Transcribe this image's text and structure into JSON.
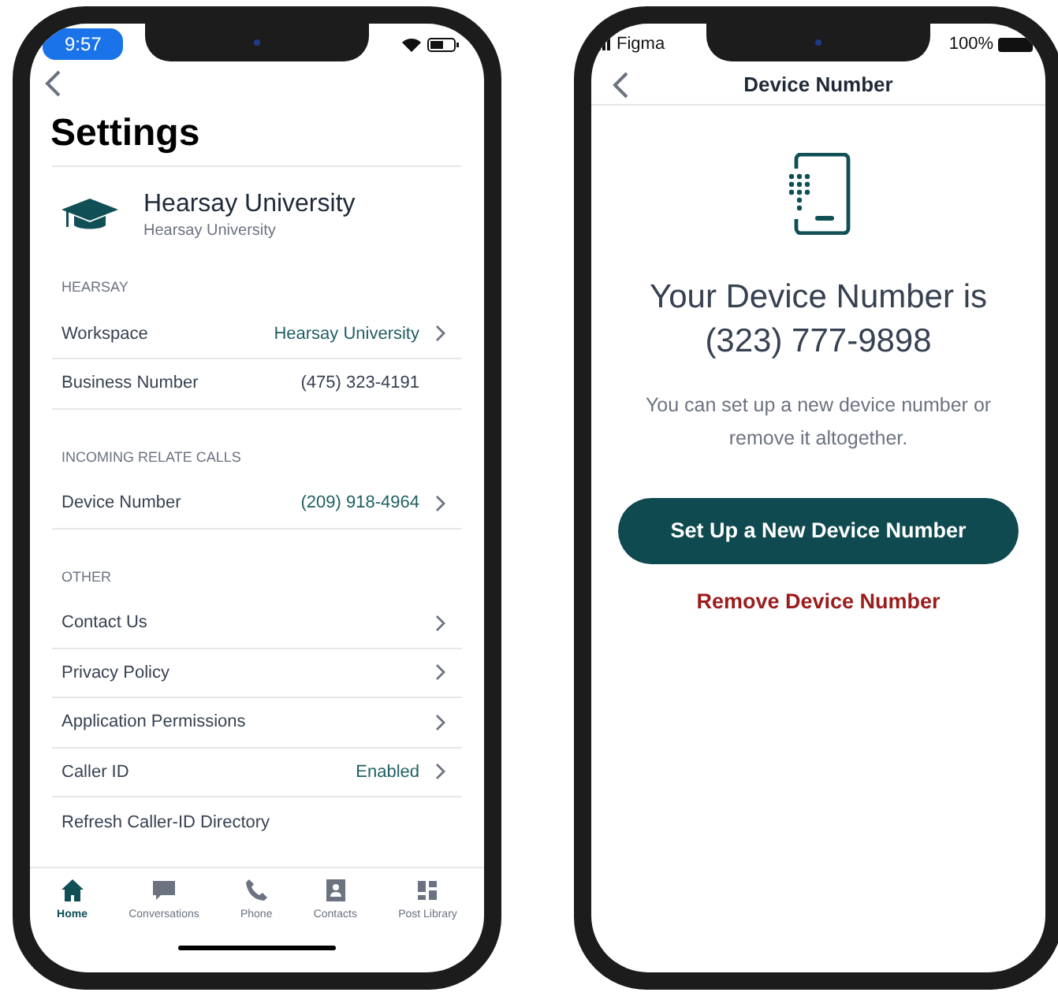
{
  "settings_screen": {
    "status_bar": {
      "time": "9:57"
    },
    "title": "Settings",
    "account": {
      "name": "Hearsay University",
      "subtitle": "Hearsay University"
    },
    "sections": [
      {
        "header": "HEARSAY",
        "rows": [
          {
            "label": "Workspace",
            "value": "Hearsay University",
            "accent": true,
            "chevron": true
          },
          {
            "label": "Business Number",
            "value": "(475) 323-4191",
            "accent": false,
            "chevron": false
          }
        ]
      },
      {
        "header": "INCOMING RELATE CALLS",
        "rows": [
          {
            "label": "Device Number",
            "value": "(209) 918-4964",
            "accent": true,
            "chevron": true
          }
        ]
      },
      {
        "header": "OTHER",
        "rows": [
          {
            "label": "Contact Us",
            "chevron": true
          },
          {
            "label": "Privacy Policy",
            "chevron": true
          },
          {
            "label": "Application Permissions",
            "chevron": true
          },
          {
            "label": "Caller ID",
            "value": "Enabled",
            "accent": true,
            "chevron": true
          },
          {
            "label": "Refresh Caller-ID Directory",
            "chevron": false
          }
        ]
      }
    ],
    "tab_bar": [
      {
        "kind": "home",
        "label": "Home",
        "selected": true
      },
      {
        "kind": "chat",
        "label": "Conversations",
        "selected": false
      },
      {
        "kind": "phone",
        "label": "Phone",
        "selected": false
      },
      {
        "kind": "contacts",
        "label": "Contacts",
        "selected": false
      },
      {
        "kind": "library",
        "label": "Post Library",
        "selected": false
      }
    ]
  },
  "device_screen": {
    "status_bar": {
      "carrier": "Figma",
      "battery": "100%"
    },
    "title": "Device Number",
    "heading": "Your Device Number is",
    "number": "(323) 777-9898",
    "description": "You can set up a new device number or remove it altogether.",
    "primary_button": "Set Up a New Device Number",
    "secondary_button": "Remove Device Number"
  }
}
